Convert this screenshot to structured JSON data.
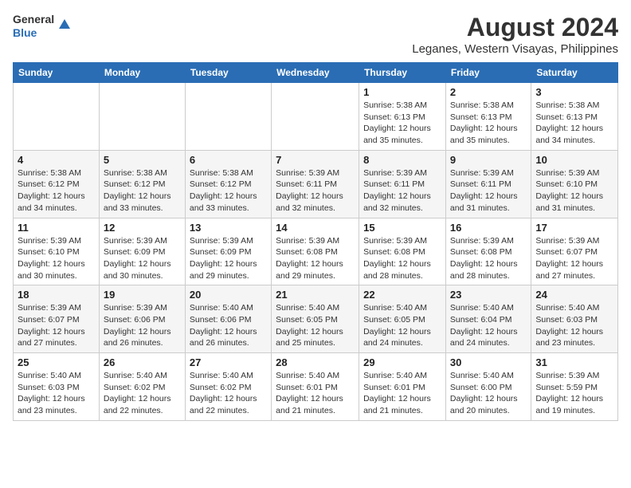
{
  "header": {
    "logo_line1": "General",
    "logo_line2": "Blue",
    "title": "August 2024",
    "subtitle": "Leganes, Western Visayas, Philippines"
  },
  "weekdays": [
    "Sunday",
    "Monday",
    "Tuesday",
    "Wednesday",
    "Thursday",
    "Friday",
    "Saturday"
  ],
  "weeks": [
    [
      {
        "day": "",
        "info": ""
      },
      {
        "day": "",
        "info": ""
      },
      {
        "day": "",
        "info": ""
      },
      {
        "day": "",
        "info": ""
      },
      {
        "day": "1",
        "info": "Sunrise: 5:38 AM\nSunset: 6:13 PM\nDaylight: 12 hours\nand 35 minutes."
      },
      {
        "day": "2",
        "info": "Sunrise: 5:38 AM\nSunset: 6:13 PM\nDaylight: 12 hours\nand 35 minutes."
      },
      {
        "day": "3",
        "info": "Sunrise: 5:38 AM\nSunset: 6:13 PM\nDaylight: 12 hours\nand 34 minutes."
      }
    ],
    [
      {
        "day": "4",
        "info": "Sunrise: 5:38 AM\nSunset: 6:12 PM\nDaylight: 12 hours\nand 34 minutes."
      },
      {
        "day": "5",
        "info": "Sunrise: 5:38 AM\nSunset: 6:12 PM\nDaylight: 12 hours\nand 33 minutes."
      },
      {
        "day": "6",
        "info": "Sunrise: 5:38 AM\nSunset: 6:12 PM\nDaylight: 12 hours\nand 33 minutes."
      },
      {
        "day": "7",
        "info": "Sunrise: 5:39 AM\nSunset: 6:11 PM\nDaylight: 12 hours\nand 32 minutes."
      },
      {
        "day": "8",
        "info": "Sunrise: 5:39 AM\nSunset: 6:11 PM\nDaylight: 12 hours\nand 32 minutes."
      },
      {
        "day": "9",
        "info": "Sunrise: 5:39 AM\nSunset: 6:11 PM\nDaylight: 12 hours\nand 31 minutes."
      },
      {
        "day": "10",
        "info": "Sunrise: 5:39 AM\nSunset: 6:10 PM\nDaylight: 12 hours\nand 31 minutes."
      }
    ],
    [
      {
        "day": "11",
        "info": "Sunrise: 5:39 AM\nSunset: 6:10 PM\nDaylight: 12 hours\nand 30 minutes."
      },
      {
        "day": "12",
        "info": "Sunrise: 5:39 AM\nSunset: 6:09 PM\nDaylight: 12 hours\nand 30 minutes."
      },
      {
        "day": "13",
        "info": "Sunrise: 5:39 AM\nSunset: 6:09 PM\nDaylight: 12 hours\nand 29 minutes."
      },
      {
        "day": "14",
        "info": "Sunrise: 5:39 AM\nSunset: 6:08 PM\nDaylight: 12 hours\nand 29 minutes."
      },
      {
        "day": "15",
        "info": "Sunrise: 5:39 AM\nSunset: 6:08 PM\nDaylight: 12 hours\nand 28 minutes."
      },
      {
        "day": "16",
        "info": "Sunrise: 5:39 AM\nSunset: 6:08 PM\nDaylight: 12 hours\nand 28 minutes."
      },
      {
        "day": "17",
        "info": "Sunrise: 5:39 AM\nSunset: 6:07 PM\nDaylight: 12 hours\nand 27 minutes."
      }
    ],
    [
      {
        "day": "18",
        "info": "Sunrise: 5:39 AM\nSunset: 6:07 PM\nDaylight: 12 hours\nand 27 minutes."
      },
      {
        "day": "19",
        "info": "Sunrise: 5:39 AM\nSunset: 6:06 PM\nDaylight: 12 hours\nand 26 minutes."
      },
      {
        "day": "20",
        "info": "Sunrise: 5:40 AM\nSunset: 6:06 PM\nDaylight: 12 hours\nand 26 minutes."
      },
      {
        "day": "21",
        "info": "Sunrise: 5:40 AM\nSunset: 6:05 PM\nDaylight: 12 hours\nand 25 minutes."
      },
      {
        "day": "22",
        "info": "Sunrise: 5:40 AM\nSunset: 6:05 PM\nDaylight: 12 hours\nand 24 minutes."
      },
      {
        "day": "23",
        "info": "Sunrise: 5:40 AM\nSunset: 6:04 PM\nDaylight: 12 hours\nand 24 minutes."
      },
      {
        "day": "24",
        "info": "Sunrise: 5:40 AM\nSunset: 6:03 PM\nDaylight: 12 hours\nand 23 minutes."
      }
    ],
    [
      {
        "day": "25",
        "info": "Sunrise: 5:40 AM\nSunset: 6:03 PM\nDaylight: 12 hours\nand 23 minutes."
      },
      {
        "day": "26",
        "info": "Sunrise: 5:40 AM\nSunset: 6:02 PM\nDaylight: 12 hours\nand 22 minutes."
      },
      {
        "day": "27",
        "info": "Sunrise: 5:40 AM\nSunset: 6:02 PM\nDaylight: 12 hours\nand 22 minutes."
      },
      {
        "day": "28",
        "info": "Sunrise: 5:40 AM\nSunset: 6:01 PM\nDaylight: 12 hours\nand 21 minutes."
      },
      {
        "day": "29",
        "info": "Sunrise: 5:40 AM\nSunset: 6:01 PM\nDaylight: 12 hours\nand 21 minutes."
      },
      {
        "day": "30",
        "info": "Sunrise: 5:40 AM\nSunset: 6:00 PM\nDaylight: 12 hours\nand 20 minutes."
      },
      {
        "day": "31",
        "info": "Sunrise: 5:39 AM\nSunset: 5:59 PM\nDaylight: 12 hours\nand 19 minutes."
      }
    ]
  ]
}
